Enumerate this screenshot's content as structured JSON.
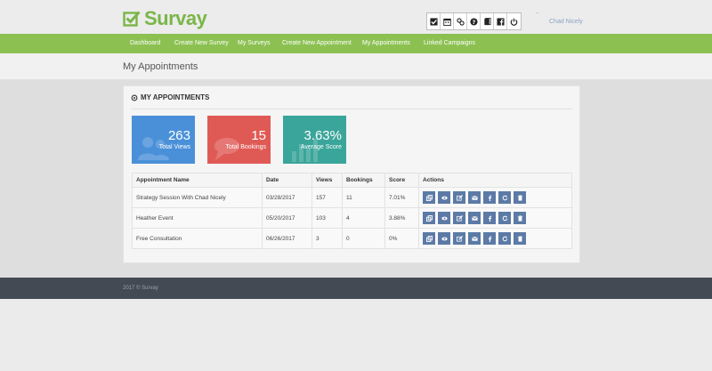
{
  "app": {
    "logo_text": "Survay",
    "brand_color": "#8cc152"
  },
  "header": {
    "toolbar_icons": [
      "checkbox-icon",
      "calendar-icon",
      "link-icon",
      "help-icon",
      "book-icon",
      "facebook-icon",
      "power-icon"
    ],
    "user_name": "Chad Nicely"
  },
  "nav": {
    "items": [
      "Dashboard",
      "Create New Survey",
      "My Surveys",
      "Create New Appointment",
      "My Appointments",
      "Linked Campaigns"
    ]
  },
  "page": {
    "title": "My Appointments"
  },
  "panel": {
    "title": "MY APPOINTMENTS"
  },
  "stats": [
    {
      "value": "263",
      "label": "Total Views",
      "color": "#4a90d9"
    },
    {
      "value": "15",
      "label": "Total Bookings",
      "color": "#e05a55"
    },
    {
      "value": "3.63%",
      "label": "Average Score",
      "color": "#3aa59a"
    }
  ],
  "table": {
    "headers": [
      "Appointment Name",
      "Date",
      "Views",
      "Bookings",
      "Score",
      "Actions"
    ],
    "rows": [
      {
        "name": "Strategy Session With Chad Nicely",
        "date": "03/28/2017",
        "views": "157",
        "bookings": "11",
        "score": "7.01%"
      },
      {
        "name": "Heather Event",
        "date": "05/20/2017",
        "views": "103",
        "bookings": "4",
        "score": "3.88%"
      },
      {
        "name": "Free Consultation",
        "date": "06/26/2017",
        "views": "3",
        "bookings": "0",
        "score": "0%"
      }
    ],
    "action_icons": [
      "copy-icon",
      "view-icon",
      "edit-icon",
      "email-icon",
      "facebook-icon",
      "refresh-icon",
      "delete-icon"
    ],
    "action_color": "#5c7aa6"
  },
  "footer": {
    "text": "2017 © Survay"
  }
}
